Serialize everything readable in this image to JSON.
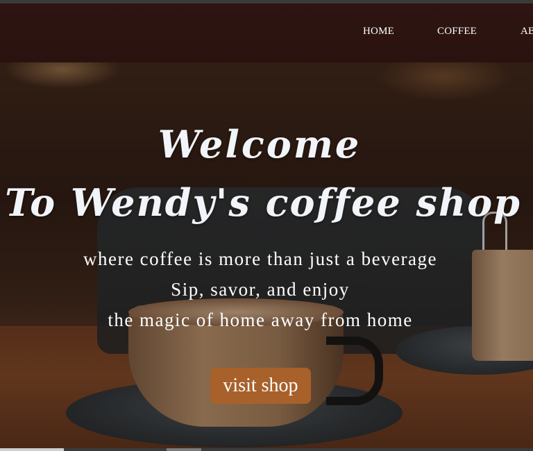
{
  "nav": {
    "items": [
      {
        "label": "HOME"
      },
      {
        "label": "COFFEE"
      },
      {
        "label": "AB"
      }
    ]
  },
  "hero": {
    "title_line1": "Welcome",
    "title_line2": "To Wendy's coffee shop",
    "tagline": [
      "where coffee is more than just a beverage",
      "Sip, savor, and enjoy",
      "the magic of home away from home"
    ],
    "button_label": "visit shop"
  },
  "colors": {
    "nav_bg": "#2c1410",
    "button_bg": "#a8612b",
    "title_text": "#f1f4f8"
  }
}
